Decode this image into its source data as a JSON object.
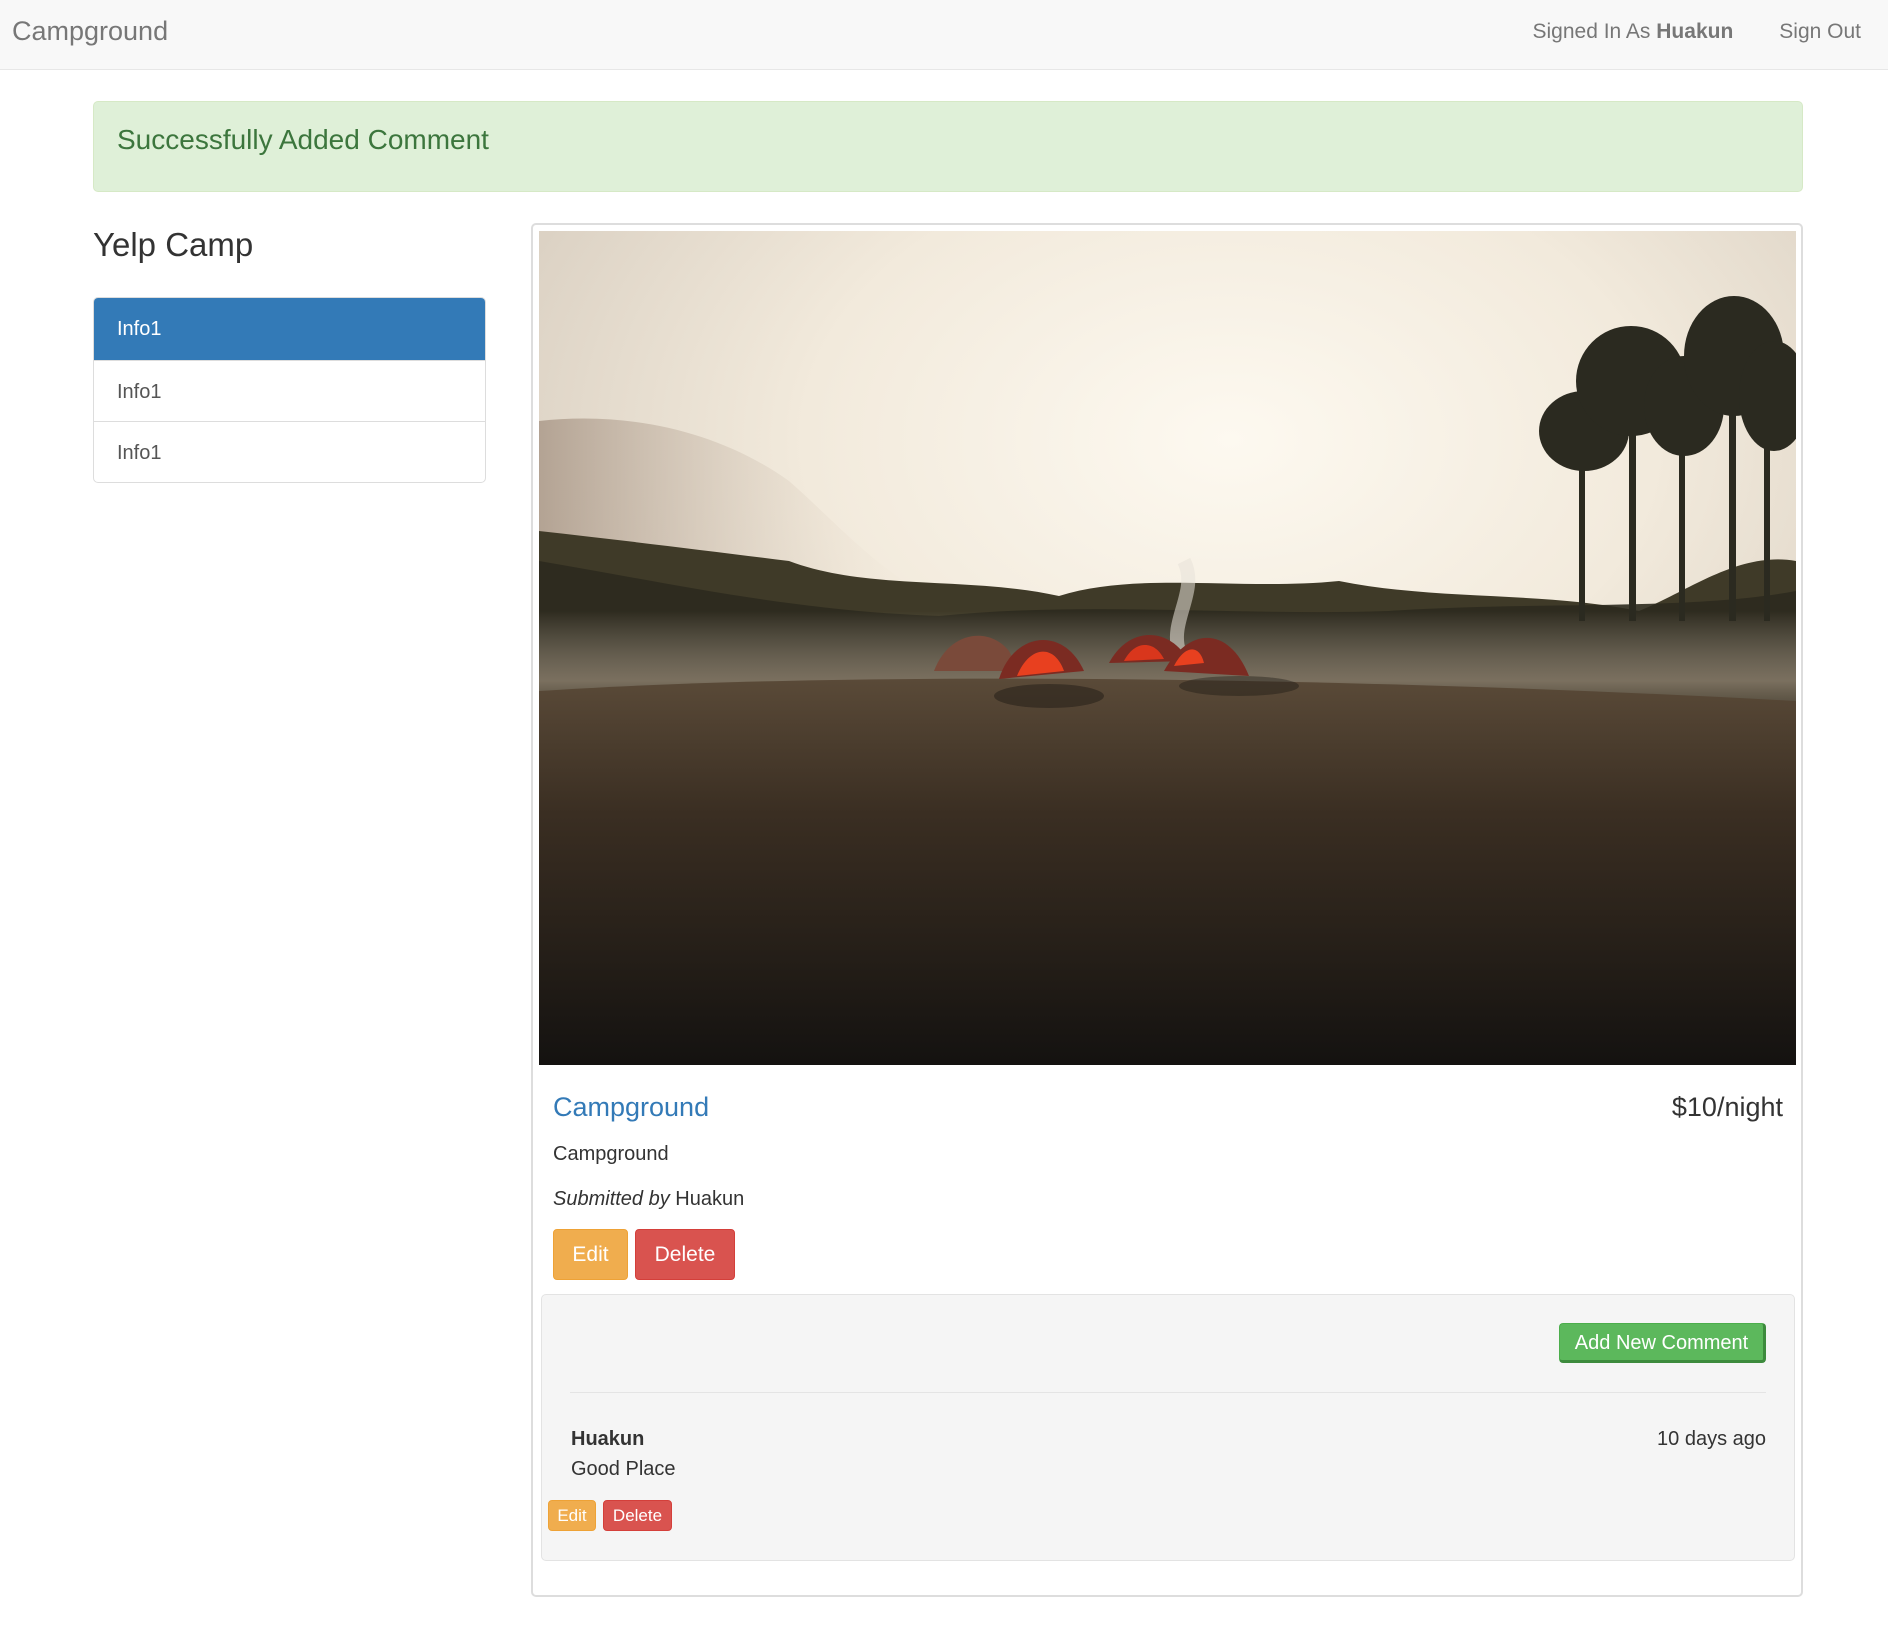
{
  "navbar": {
    "brand": "Campground",
    "signed_in_prefix": "Signed In As",
    "username": "Huakun",
    "sign_out": "Sign Out"
  },
  "alert": {
    "message": "Successfully Added Comment"
  },
  "sidebar": {
    "title": "Yelp Camp",
    "items": [
      {
        "label": "Info1",
        "active": true
      },
      {
        "label": "Info1",
        "active": false
      },
      {
        "label": "Info1",
        "active": false
      }
    ]
  },
  "campground": {
    "name": "Campground",
    "price": "$10/night",
    "description": "Campground",
    "submitted_label": "Submitted by",
    "author": "Huakun",
    "edit_label": "Edit",
    "delete_label": "Delete"
  },
  "comments": {
    "add_label": "Add New Comment",
    "items": [
      {
        "author": "Huakun",
        "time": "10 days ago",
        "text": "Good Place",
        "edit_label": "Edit",
        "delete_label": "Delete"
      }
    ]
  },
  "colors": {
    "primary": "#337ab7",
    "success_bg": "#dff0d8",
    "success_text": "#3c763d",
    "warning": "#f0ad4e",
    "danger": "#d9534f",
    "success_btn": "#5cb85c"
  }
}
